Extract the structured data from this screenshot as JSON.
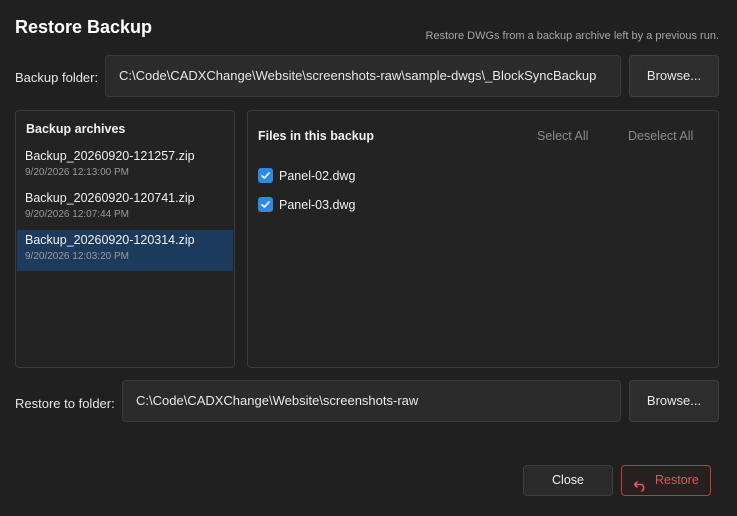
{
  "dialog": {
    "title": "Restore Backup",
    "subtitle": "Restore DWGs from a backup archive left by a previous run."
  },
  "backup_folder": {
    "label": "Backup folder:",
    "value": "C:\\Code\\CADXChange\\Website\\screenshots-raw\\sample-dwgs\\_BlockSyncBackup",
    "browse_label": "Browse..."
  },
  "archives": {
    "heading": "Backup archives",
    "items": [
      {
        "name": "Backup_20260920-121257.zip",
        "date": "9/20/2026 12:13:00 PM",
        "selected": false
      },
      {
        "name": "Backup_20260920-120741.zip",
        "date": "9/20/2026 12:07:44 PM",
        "selected": false
      },
      {
        "name": "Backup_20260920-120314.zip",
        "date": "9/20/2026 12:03:20 PM",
        "selected": true
      }
    ]
  },
  "files": {
    "heading": "Files in this backup",
    "select_all_label": "Select All",
    "deselect_all_label": "Deselect All",
    "items": [
      {
        "name": "Panel-02.dwg",
        "checked": true
      },
      {
        "name": "Panel-03.dwg",
        "checked": true
      }
    ]
  },
  "restore_folder": {
    "label": "Restore to folder:",
    "value": "C:\\Code\\CADXChange\\Website\\screenshots-raw",
    "browse_label": "Browse..."
  },
  "actions": {
    "close_label": "Close",
    "restore_label": "Restore",
    "restore_icon": "undo-arrow-icon"
  },
  "colors": {
    "accent": "#2f8ae6",
    "selected_row": "#1c3a5c",
    "danger": "#e05555"
  }
}
